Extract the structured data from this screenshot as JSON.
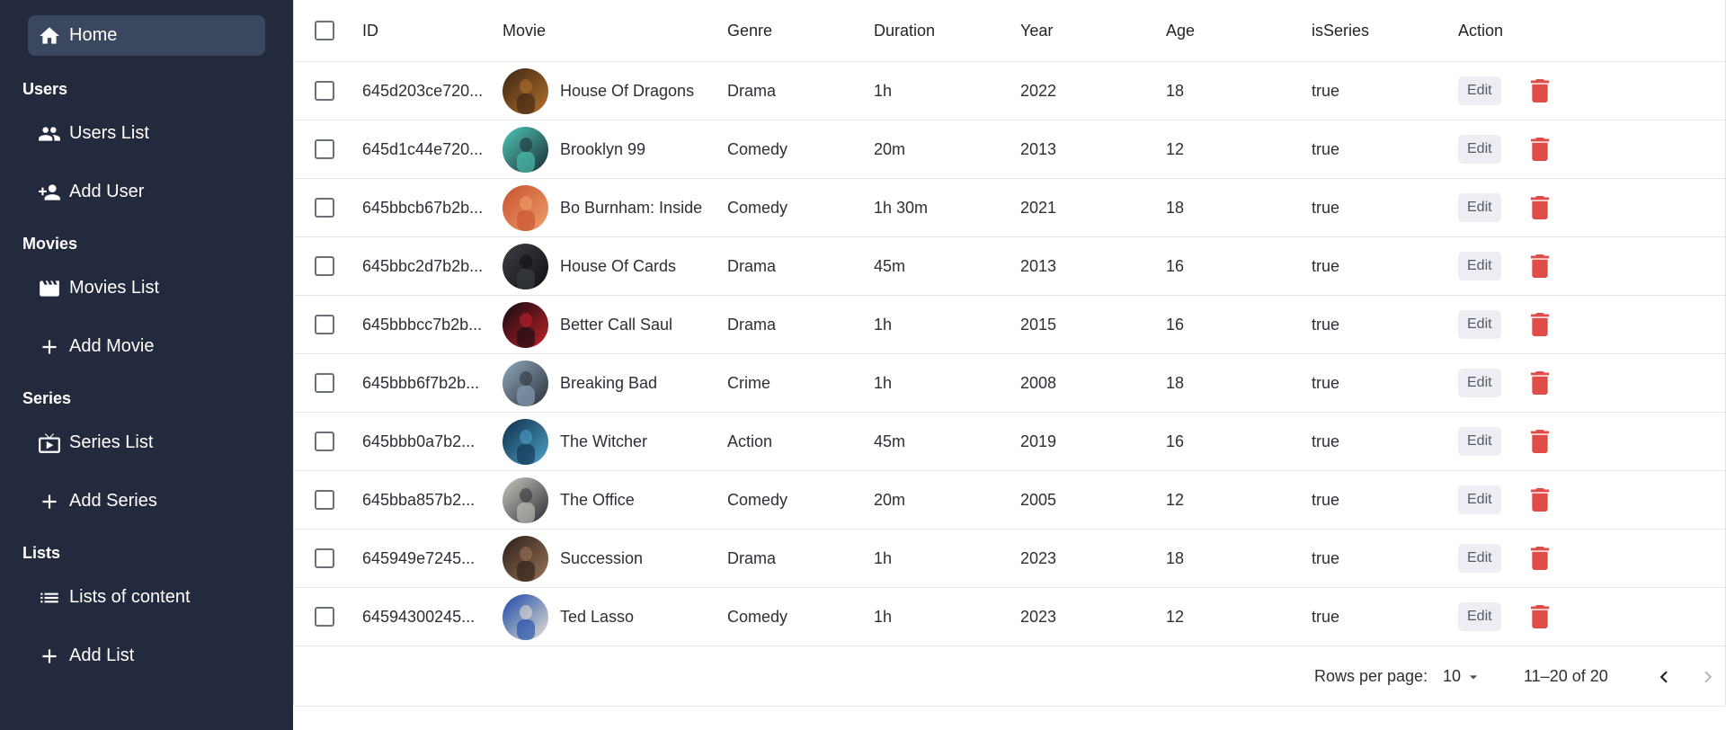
{
  "sidebar": {
    "home": {
      "label": "Home",
      "icon": "home-icon"
    },
    "groups": [
      {
        "title": "Users",
        "items": [
          {
            "label": "Users List",
            "icon": "users-icon"
          },
          {
            "label": "Add User",
            "icon": "person-add-icon"
          }
        ]
      },
      {
        "title": "Movies",
        "items": [
          {
            "label": "Movies List",
            "icon": "movie-icon"
          },
          {
            "label": "Add Movie",
            "icon": "plus-icon"
          }
        ]
      },
      {
        "title": "Series",
        "items": [
          {
            "label": "Series List",
            "icon": "tv-icon"
          },
          {
            "label": "Add Series",
            "icon": "plus-icon"
          }
        ]
      },
      {
        "title": "Lists",
        "items": [
          {
            "label": "Lists of content",
            "icon": "list-icon"
          },
          {
            "label": "Add List",
            "icon": "plus-icon"
          }
        ]
      }
    ]
  },
  "table": {
    "columns": [
      "ID",
      "Movie",
      "Genre",
      "Duration",
      "Year",
      "Age",
      "isSeries",
      "Action"
    ],
    "edit_label": "Edit",
    "rows": [
      {
        "id": "645d203ce720...",
        "movie": "House Of Dragons",
        "genre": "Drama",
        "duration": "1h",
        "year": "2022",
        "age": "18",
        "isSeries": "true",
        "avatar_colors": [
          "#3a2414",
          "#b5722c"
        ]
      },
      {
        "id": "645d1c44e720...",
        "movie": "Brooklyn 99",
        "genre": "Comedy",
        "duration": "20m",
        "year": "2013",
        "age": "12",
        "isSeries": "true",
        "avatar_colors": [
          "#4fc9b8",
          "#1d2b33"
        ]
      },
      {
        "id": "645bbcb67b2b...",
        "movie": "Bo Burnham: Inside",
        "genre": "Comedy",
        "duration": "1h 30m",
        "year": "2021",
        "age": "18",
        "isSeries": "true",
        "avatar_colors": [
          "#c7502f",
          "#f0a06a"
        ]
      },
      {
        "id": "645bbc2d7b2b...",
        "movie": "House Of Cards",
        "genre": "Drama",
        "duration": "45m",
        "year": "2013",
        "age": "16",
        "isSeries": "true",
        "avatar_colors": [
          "#3c3f44",
          "#0f1012"
        ]
      },
      {
        "id": "645bbbcc7b2b...",
        "movie": "Better Call Saul",
        "genre": "Drama",
        "duration": "1h",
        "year": "2015",
        "age": "16",
        "isSeries": "true",
        "avatar_colors": [
          "#0d0d10",
          "#c4202a"
        ]
      },
      {
        "id": "645bbb6f7b2b...",
        "movie": "Breaking Bad",
        "genre": "Crime",
        "duration": "1h",
        "year": "2008",
        "age": "18",
        "isSeries": "true",
        "avatar_colors": [
          "#8fa7be",
          "#2c3138"
        ]
      },
      {
        "id": "645bbb0a7b2...",
        "movie": "The Witcher",
        "genre": "Action",
        "duration": "45m",
        "year": "2019",
        "age": "16",
        "isSeries": "true",
        "avatar_colors": [
          "#0f2d4b",
          "#4da3c8"
        ]
      },
      {
        "id": "645bba857b2...",
        "movie": "The Office",
        "genre": "Comedy",
        "duration": "20m",
        "year": "2005",
        "age": "12",
        "isSeries": "true",
        "avatar_colors": [
          "#c9c8c0",
          "#2a2e34"
        ]
      },
      {
        "id": "645949e7245...",
        "movie": "Succession",
        "genre": "Drama",
        "duration": "1h",
        "year": "2023",
        "age": "18",
        "isSeries": "true",
        "avatar_colors": [
          "#2a1d18",
          "#9a7457"
        ]
      },
      {
        "id": "64594300245...",
        "movie": "Ted Lasso",
        "genre": "Comedy",
        "duration": "1h",
        "year": "2023",
        "age": "12",
        "isSeries": "true",
        "avatar_colors": [
          "#1646a8",
          "#e9e2d3"
        ]
      }
    ]
  },
  "footer": {
    "rows_per_page_label": "Rows per page:",
    "rows_per_page_value": "10",
    "range": "11–20 of 20"
  },
  "colors": {
    "sidebar_bg": "#232a3e",
    "active_bg": "#3b465f",
    "delete": "#e04c48"
  }
}
